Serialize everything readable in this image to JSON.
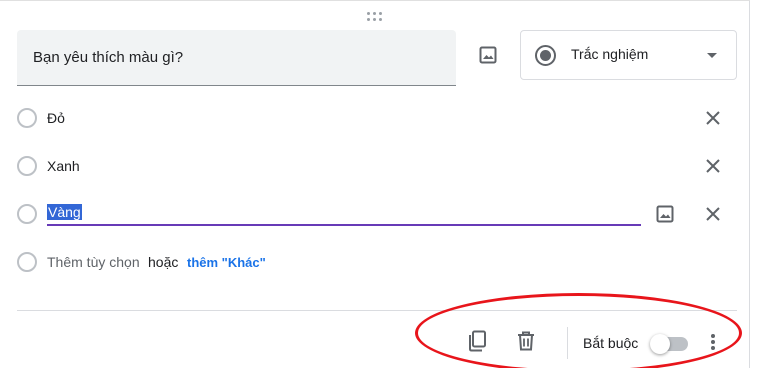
{
  "question": {
    "title": "Bạn yêu thích màu gì?",
    "image_icon": "image-icon"
  },
  "type_select": {
    "icon": "radio-checked-icon",
    "label": "Trắc nghiệm",
    "caret_icon": "arrow-drop-down-icon"
  },
  "options": [
    {
      "label": "Đỏ",
      "remove_icon": "close-icon"
    },
    {
      "label": "Xanh",
      "remove_icon": "close-icon"
    },
    {
      "label": "Vàng",
      "selected_text": true,
      "image_icon": "image-icon",
      "remove_icon": "close-icon"
    }
  ],
  "add_row": {
    "add_option": "Thêm tùy chọn",
    "or": "hoặc",
    "add_other": "thêm \"Khác\""
  },
  "footer": {
    "duplicate_icon": "content-copy-icon",
    "delete_icon": "trash-icon",
    "required_label": "Bắt buộc",
    "required_on": false,
    "more_icon": "more-vert-icon"
  },
  "colors": {
    "accent": "#673ab7",
    "link": "#1a73e8",
    "selection": "#3367d6",
    "annotation": "#e8151b"
  }
}
